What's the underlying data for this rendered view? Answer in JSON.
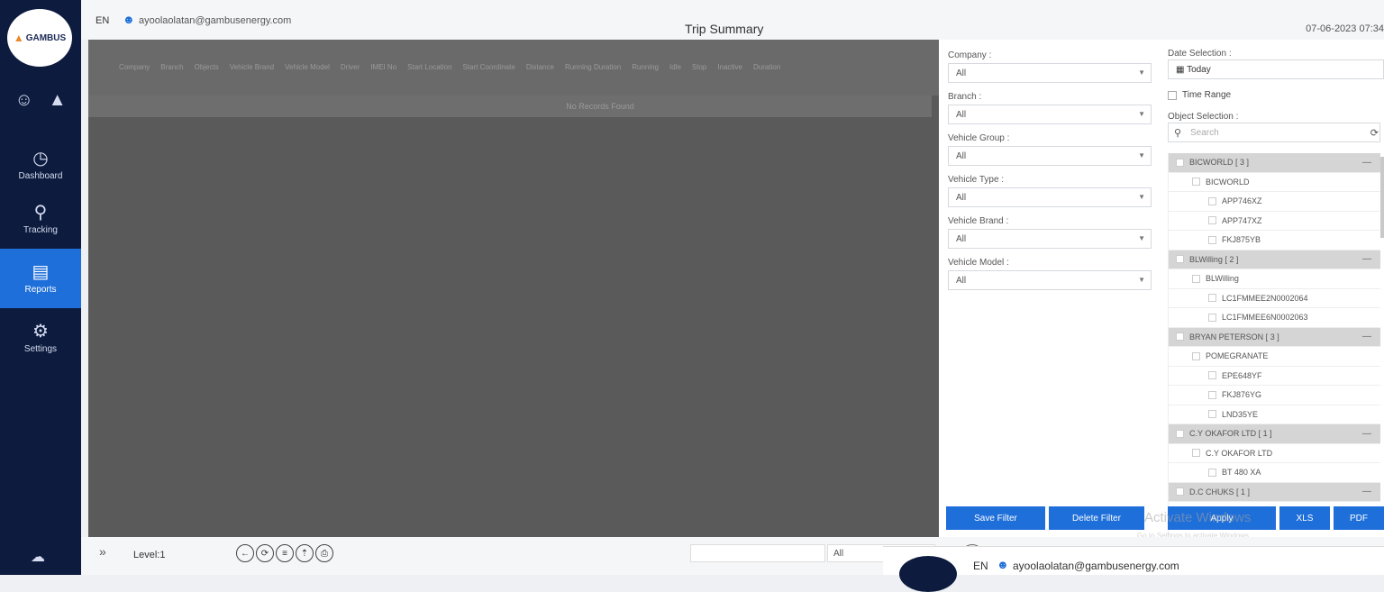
{
  "sidebar": {
    "logo_text": "GAMBUS",
    "items": [
      {
        "label": "Dashboard",
        "icon": "speedometer-icon"
      },
      {
        "label": "Tracking",
        "icon": "map-pin-icon"
      },
      {
        "label": "Reports",
        "icon": "report-icon"
      },
      {
        "label": "Settings",
        "icon": "gear-icon"
      }
    ]
  },
  "topbar": {
    "lang": "EN",
    "email": "ayoolaolatan@gambusenergy.com",
    "title": "Trip Summary",
    "datetime": "07-06-2023 07:34"
  },
  "grid": {
    "columns": [
      "Company",
      "Branch",
      "Objects",
      "Vehicle Brand",
      "Vehicle Model",
      "Driver",
      "IMEI No",
      "Start Location",
      "Start Coordinate",
      "Distance",
      "Running Duration",
      "Running",
      "Idle",
      "Stop",
      "Inactive",
      "Duration"
    ],
    "empty_text": "No Records Found"
  },
  "filters": {
    "company": {
      "label": "Company :",
      "value": "All"
    },
    "branch": {
      "label": "Branch :",
      "value": "All"
    },
    "vehicle_group": {
      "label": "Vehicle Group :",
      "value": "All"
    },
    "vehicle_type": {
      "label": "Vehicle Type :",
      "value": "All"
    },
    "vehicle_brand": {
      "label": "Vehicle Brand :",
      "value": "All"
    },
    "vehicle_model": {
      "label": "Vehicle Model :",
      "value": "All"
    }
  },
  "objects": {
    "date_selection_label": "Date Selection :",
    "date_value": "Today",
    "time_range_label": "Time Range",
    "object_selection_label": "Object Selection :",
    "search_placeholder": "Search",
    "tree": [
      {
        "text": "BICWORLD [ 3 ]",
        "level": 0,
        "group": true
      },
      {
        "text": "BICWORLD",
        "level": 1,
        "group": false
      },
      {
        "text": "APP746XZ",
        "level": 2,
        "group": false
      },
      {
        "text": "APP747XZ",
        "level": 2,
        "group": false
      },
      {
        "text": "FKJ875YB",
        "level": 2,
        "group": false
      },
      {
        "text": "BLWilling [ 2 ]",
        "level": 0,
        "group": true
      },
      {
        "text": "BLWilling",
        "level": 1,
        "group": false
      },
      {
        "text": "LC1FMMEE2N0002064",
        "level": 2,
        "group": false
      },
      {
        "text": "LC1FMMEE6N0002063",
        "level": 2,
        "group": false
      },
      {
        "text": "BRYAN PETERSON [ 3 ]",
        "level": 0,
        "group": true
      },
      {
        "text": "POMEGRANATE",
        "level": 1,
        "group": false
      },
      {
        "text": "EPE648YF",
        "level": 2,
        "group": false
      },
      {
        "text": "FKJ876YG",
        "level": 2,
        "group": false
      },
      {
        "text": "LND35YE",
        "level": 2,
        "group": false
      },
      {
        "text": "C.Y OKAFOR LTD [ 1 ]",
        "level": 0,
        "group": true
      },
      {
        "text": "C.Y OKAFOR LTD",
        "level": 1,
        "group": false
      },
      {
        "text": "BT 480 XA",
        "level": 2,
        "group": false
      },
      {
        "text": "D.C CHUKS [ 1 ]",
        "level": 0,
        "group": true
      }
    ]
  },
  "buttons": {
    "save_filter": "Save Filter",
    "delete_filter": "Delete Filter",
    "apply": "Apply",
    "xls": "XLS",
    "pdf": "PDF"
  },
  "watermark": {
    "title": "Activate Windows",
    "subtitle": "Go to Settings to activate Windows."
  },
  "bottombar": {
    "level": "Level:1",
    "select_value": "All"
  },
  "overlay": {
    "lang": "EN",
    "email": "ayoolaolatan@gambusenergy.com"
  }
}
